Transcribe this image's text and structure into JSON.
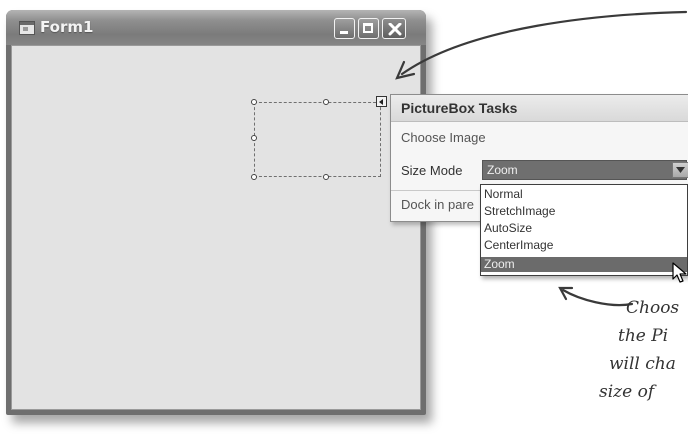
{
  "window": {
    "title": "Form1",
    "icon": "form-app-icon",
    "buttons": [
      "minimize-icon",
      "maximize-icon",
      "close-icon"
    ]
  },
  "picturebox": {
    "smart_tag_icon": "smart-tag-arrow-icon"
  },
  "tasks_panel": {
    "title": "PictureBox Tasks",
    "choose_image": "Choose Image",
    "size_mode_label": "Size Mode",
    "size_mode_value": "Zoom",
    "dock_text": "Dock in pare"
  },
  "dropdown": {
    "items": [
      "Normal",
      "StretchImage",
      "AutoSize",
      "CenterImage",
      "Zoom"
    ],
    "selected": "Zoom"
  },
  "annotation": {
    "lines": [
      "Choos",
      "the Pi",
      "will cha",
      "size of"
    ]
  },
  "colors": {
    "titlebar": "#8f8f8f",
    "client_area": "#e3e3e3",
    "selected_item": "#6b6b6b",
    "panel_background": "#f6f6f6"
  }
}
